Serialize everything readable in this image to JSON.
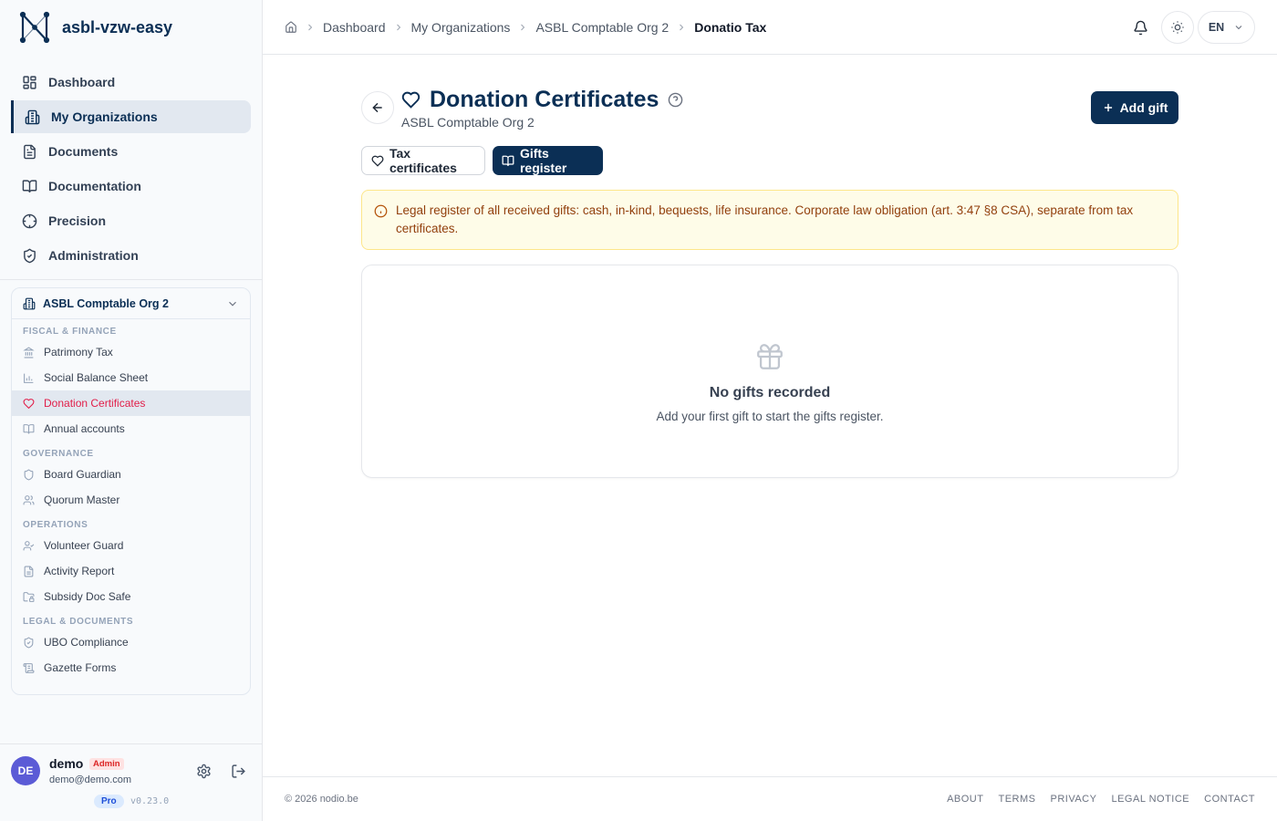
{
  "brand": {
    "name": "asbl-vzw-easy"
  },
  "nav": [
    {
      "label": "Dashboard",
      "icon": "dashboard-icon"
    },
    {
      "label": "My Organizations",
      "icon": "building-icon",
      "active": true
    },
    {
      "label": "Documents",
      "icon": "document-icon"
    },
    {
      "label": "Documentation",
      "icon": "book-icon"
    },
    {
      "label": "Precision",
      "icon": "crosshair-icon"
    },
    {
      "label": "Administration",
      "icon": "shield-icon"
    }
  ],
  "org_panel": {
    "name": "ASBL Comptable Org 2",
    "sections": [
      {
        "label": "FISCAL & FINANCE",
        "items": [
          "Patrimony Tax",
          "Social Balance Sheet",
          "Donation Certificates",
          "Annual accounts"
        ]
      },
      {
        "label": "GOVERNANCE",
        "items": [
          "Board Guardian",
          "Quorum Master"
        ]
      },
      {
        "label": "OPERATIONS",
        "items": [
          "Volunteer Guard",
          "Activity Report",
          "Subsidy Doc Safe"
        ]
      },
      {
        "label": "LEGAL & DOCUMENTS",
        "items": [
          "UBO Compliance",
          "Gazette Forms"
        ]
      }
    ],
    "active_item": "Donation Certificates"
  },
  "user": {
    "initials": "DE",
    "name": "demo",
    "role": "Admin",
    "email": "demo@demo.com",
    "plan": "Pro",
    "version": "v0.23.0"
  },
  "breadcrumbs": [
    "Dashboard",
    "My Organizations",
    "ASBL Comptable Org 2",
    "Donatio Tax"
  ],
  "topbar": {
    "language": "EN"
  },
  "page": {
    "title": "Donation Certificates",
    "subtitle": "ASBL Comptable Org 2",
    "add_button": "Add gift",
    "tabs": [
      {
        "label": "Tax certificates",
        "active": false
      },
      {
        "label": "Gifts register",
        "active": true
      }
    ],
    "notice": "Legal register of all received gifts: cash, in-kind, bequests, life insurance. Corporate law obligation (art. 3:47 §8 CSA), separate from tax certificates.",
    "empty_title": "No gifts recorded",
    "empty_description": "Add your first gift to start the gifts register."
  },
  "footer": {
    "copyright": "© 2026 nodio.be",
    "links": [
      "ABOUT",
      "TERMS",
      "PRIVACY",
      "LEGAL NOTICE",
      "CONTACT"
    ]
  },
  "colors": {
    "brand": "#0b2f55",
    "active_item": "#e11d48",
    "notice_bg": "#fefce8",
    "avatar": "#5b5bd6"
  }
}
